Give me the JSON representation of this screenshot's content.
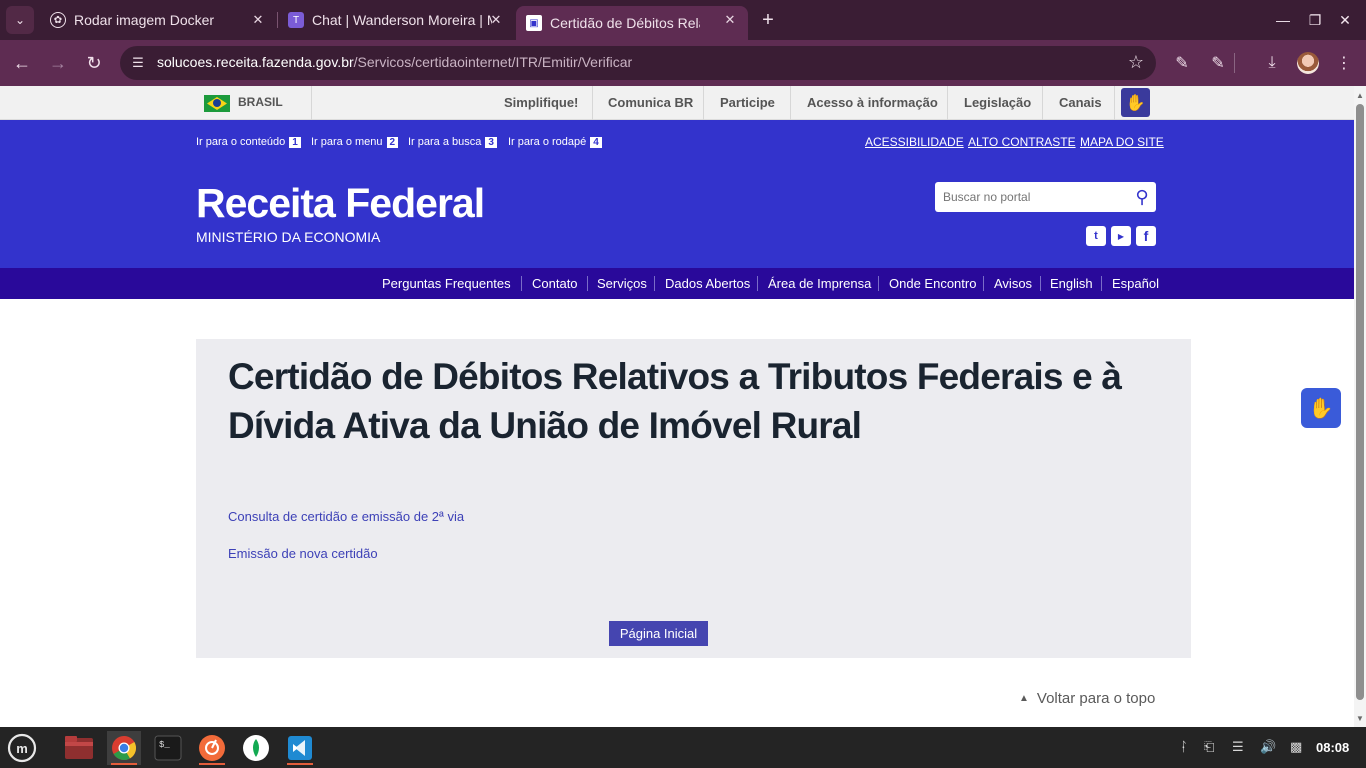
{
  "browser": {
    "tabs": [
      {
        "title": "Rodar imagem Docker",
        "icon": "chatgpt-icon"
      },
      {
        "title": "Chat | Wanderson Moreira | Microsoft Teams",
        "icon": "teams-icon"
      },
      {
        "title": "Certidão de Débitos Relativos",
        "icon": "receita-icon"
      }
    ],
    "url_host": "solucoes.receita.fazenda.gov.br",
    "url_path": "/Servicos/certidaointernet/ITR/Emitir/Verificar"
  },
  "gov_bar": {
    "country": "BRASIL",
    "links": [
      "Simplifique!",
      "Comunica BR",
      "Participe",
      "Acesso à informação",
      "Legislação",
      "Canais"
    ]
  },
  "header": {
    "skip_links": [
      {
        "label": "Ir para o conteúdo",
        "key": "1"
      },
      {
        "label": "Ir para o menu",
        "key": "2"
      },
      {
        "label": "Ir para a busca",
        "key": "3"
      },
      {
        "label": "Ir para o rodapé",
        "key": "4"
      }
    ],
    "top_links": [
      "ACESSIBILIDADE",
      "ALTO CONTRASTE",
      "MAPA DO SITE"
    ],
    "brand": "Receita Federal",
    "ministry": "MINISTÉRIO DA ECONOMIA",
    "search_placeholder": "Buscar no portal",
    "colors": {
      "header": "#3333cc",
      "nav": "#29099a"
    }
  },
  "main_nav": [
    "Perguntas Frequentes",
    "Contato",
    "Serviços",
    "Dados Abertos",
    "Área de Imprensa",
    "Onde Encontro",
    "Avisos",
    "English",
    "Español"
  ],
  "content": {
    "title": "Certidão de Débitos Relativos a Tributos Federais e à Dívida Ativa da União de Imóvel Rural",
    "links": [
      "Consulta de certidão e emissão de 2ª via",
      "Emissão de nova certidão"
    ],
    "home_button": "Página Inicial"
  },
  "back_to_top": "Voltar para o topo",
  "taskbar": {
    "clock": "08:08"
  }
}
